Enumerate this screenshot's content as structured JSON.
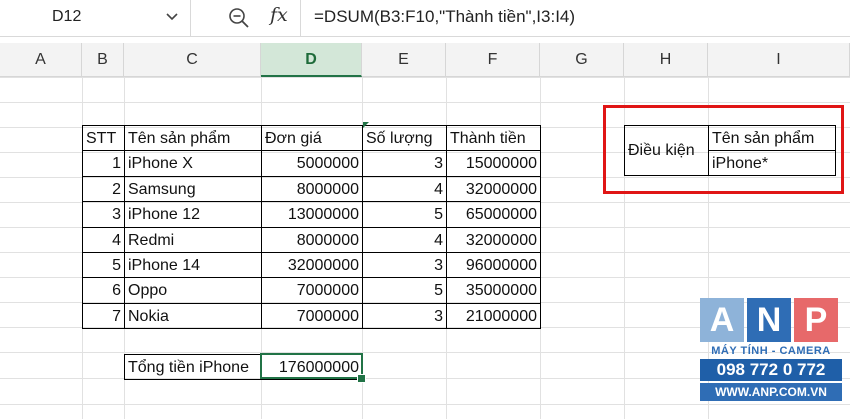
{
  "formula_bar": {
    "name_box": "D12",
    "fx_label": "fx",
    "formula": "=DSUM(B3:F10,\"Thành tiền\",I3:I4)"
  },
  "columns": [
    "A",
    "B",
    "C",
    "D",
    "E",
    "F",
    "G",
    "H",
    "I"
  ],
  "selected_column": "D",
  "table": {
    "headers": [
      "STT",
      "Tên sản phẩm",
      "Đơn giá",
      "Số lượng",
      "Thành tiền"
    ],
    "rows": [
      [
        "1",
        "iPhone X",
        "5000000",
        "3",
        "15000000"
      ],
      [
        "2",
        "Samsung",
        "8000000",
        "4",
        "32000000"
      ],
      [
        "3",
        "iPhone 12",
        "13000000",
        "5",
        "65000000"
      ],
      [
        "4",
        "Redmi",
        "8000000",
        "4",
        "32000000"
      ],
      [
        "5",
        "iPhone 14",
        "32000000",
        "3",
        "96000000"
      ],
      [
        "6",
        "Oppo",
        "7000000",
        "5",
        "35000000"
      ],
      [
        "7",
        "Nokia",
        "7000000",
        "3",
        "21000000"
      ]
    ]
  },
  "total": {
    "label": "Tổng tiền iPhone",
    "value": "176000000"
  },
  "criteria": {
    "label": "Điều kiện",
    "field": "Tên sản phẩm",
    "value": "iPhone*"
  },
  "watermark": {
    "letters": [
      "A",
      "N",
      "P"
    ],
    "tagline": "MÁY TÍNH - CAMERA",
    "phone": "098 772 0 772",
    "website": "WWW.ANP.COM.VN"
  },
  "colors": {
    "accent": "#217346",
    "highlight": "#e01515",
    "logo_blue": "#2f6db5",
    "logo_red": "#e7696a"
  }
}
